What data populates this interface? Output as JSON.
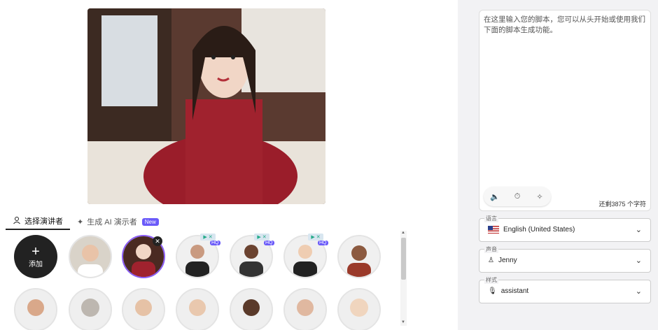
{
  "tabs": {
    "select_presenter": "选择演讲者",
    "generate_ai": "生成 AI 演示者",
    "new_badge": "New"
  },
  "grid": {
    "add_label": "添加",
    "hq_label": "HQ"
  },
  "script": {
    "placeholder": "在这里输入您的脚本，您可以从头开始或使用我们下面的脚本生成功能。",
    "counter": "还剩3875 个字符"
  },
  "language": {
    "label": "语言",
    "value": "English (United States)"
  },
  "voice": {
    "label": "声音",
    "value": "Jenny"
  },
  "style": {
    "label": "样式",
    "value": "assistant"
  },
  "colors": {
    "accent": "#6a5af9",
    "dark": "#222222",
    "preview_bg": "#7a1e24"
  }
}
